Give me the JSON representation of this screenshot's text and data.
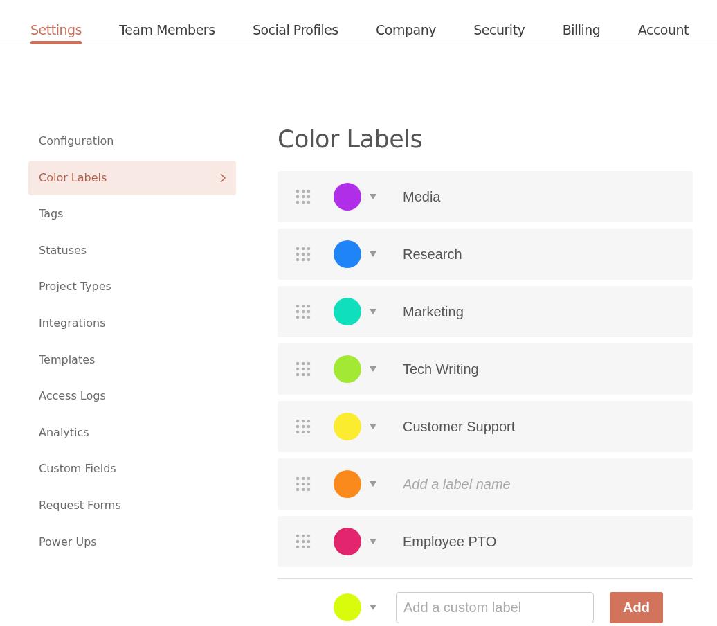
{
  "tabs": [
    {
      "label": "Settings",
      "selected": true
    },
    {
      "label": "Team Members",
      "selected": false
    },
    {
      "label": "Social Profiles",
      "selected": false
    },
    {
      "label": "Company",
      "selected": false
    },
    {
      "label": "Security",
      "selected": false
    },
    {
      "label": "Billing",
      "selected": false
    },
    {
      "label": "Account",
      "selected": false
    }
  ],
  "sidebar": {
    "items": [
      {
        "label": "Configuration",
        "selected": false
      },
      {
        "label": "Color Labels",
        "selected": true
      },
      {
        "label": "Tags",
        "selected": false
      },
      {
        "label": "Statuses",
        "selected": false
      },
      {
        "label": "Project Types",
        "selected": false
      },
      {
        "label": "Integrations",
        "selected": false
      },
      {
        "label": "Templates",
        "selected": false
      },
      {
        "label": "Access Logs",
        "selected": false
      },
      {
        "label": "Analytics",
        "selected": false
      },
      {
        "label": "Custom Fields",
        "selected": false
      },
      {
        "label": "Request Forms",
        "selected": false
      },
      {
        "label": "Power Ups",
        "selected": false
      }
    ]
  },
  "title": "Color Labels",
  "labels": [
    {
      "name": "Media",
      "color": "#b02ee8"
    },
    {
      "name": "Research",
      "color": "#1f84f7"
    },
    {
      "name": "Marketing",
      "color": "#10dfbe"
    },
    {
      "name": "Tech Writing",
      "color": "#a4e836"
    },
    {
      "name": "Customer Support",
      "color": "#fcec2f"
    },
    {
      "placeholder": "Add a label name",
      "color": "#fb8a1c"
    },
    {
      "name": "Employee PTO",
      "color": "#e2256c"
    }
  ],
  "new_label": {
    "color": "#d9fc0c",
    "placeholder": "Add a custom label",
    "button": "Add"
  }
}
